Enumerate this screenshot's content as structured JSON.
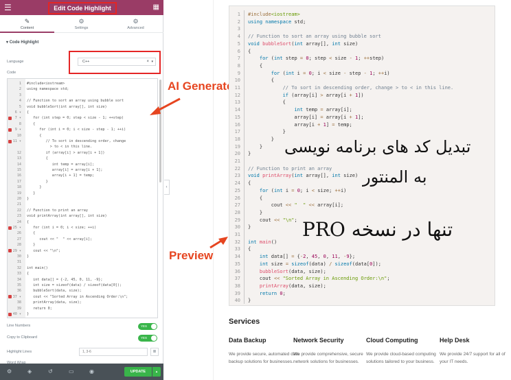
{
  "editor": {
    "title": "Edit Code Highlight",
    "tabs": [
      {
        "label": "Content",
        "icon": "✎"
      },
      {
        "label": "Settings",
        "icon": "⚙"
      },
      {
        "label": "Advanced",
        "icon": "⚙"
      }
    ],
    "section_title": "Code Highlight",
    "language_label": "Language",
    "language_value": "C++",
    "code_label": "Code",
    "code_lines": [
      {
        "n": "1",
        "t": "#include<iostream>",
        "m": false
      },
      {
        "n": "2",
        "t": "using namespace std;",
        "m": false
      },
      {
        "n": "3",
        "t": "",
        "m": false
      },
      {
        "n": "4",
        "t": "// Function to sort an array using bubble sort",
        "m": false
      },
      {
        "n": "5",
        "t": "void bubbleSort(int array[], int size)",
        "m": false
      },
      {
        "n": "6 ▾",
        "t": "{",
        "m": false
      },
      {
        "n": "7 ▾",
        "t": "   for (int step = 0; step < size - 1; ++step)",
        "m": true
      },
      {
        "n": "8",
        "t": "   {",
        "m": false
      },
      {
        "n": "9 ▾",
        "t": "      for (int i = 0; i < size - step - 1; ++i)",
        "m": true
      },
      {
        "n": "10",
        "t": "      {",
        "m": false
      },
      {
        "n": "11 ▾",
        "t": "         // To sort in descending order, change",
        "m": true
      },
      {
        "n": "",
        "t": "           > to < in this line.",
        "m": false
      },
      {
        "n": "12",
        "t": "         if (array[i] > array[i + 1])",
        "m": false
      },
      {
        "n": "13",
        "t": "         {",
        "m": false
      },
      {
        "n": "14",
        "t": "            int temp = array[i];",
        "m": false
      },
      {
        "n": "15",
        "t": "            array[i] = array[i + 1];",
        "m": false
      },
      {
        "n": "16",
        "t": "            array[i + 1] = temp;",
        "m": false
      },
      {
        "n": "17",
        "t": "         }",
        "m": false
      },
      {
        "n": "18",
        "t": "      }",
        "m": false
      },
      {
        "n": "19",
        "t": "   }",
        "m": false
      },
      {
        "n": "20",
        "t": "}",
        "m": false
      },
      {
        "n": "21",
        "t": "",
        "m": false
      },
      {
        "n": "22",
        "t": "// Function to print an array",
        "m": false
      },
      {
        "n": "23",
        "t": "void printArray(int array[], int size)",
        "m": false
      },
      {
        "n": "24",
        "t": "{",
        "m": false
      },
      {
        "n": "25 ▾",
        "t": "   for (int i = 0; i < size; ++i)",
        "m": true
      },
      {
        "n": "26",
        "t": "   {",
        "m": false
      },
      {
        "n": "27",
        "t": "      cout << \"  \" << array[i];",
        "m": false
      },
      {
        "n": "28",
        "t": "   }",
        "m": false
      },
      {
        "n": "29 ▾",
        "t": "   cout << \"\\n\";",
        "m": true
      },
      {
        "n": "30",
        "t": "}",
        "m": false
      },
      {
        "n": "31",
        "t": "",
        "m": false
      },
      {
        "n": "32",
        "t": "int main()",
        "m": false
      },
      {
        "n": "33",
        "t": "{",
        "m": false
      },
      {
        "n": "34",
        "t": "   int data[] = {-2, 45, 0, 11, -9};",
        "m": false
      },
      {
        "n": "35",
        "t": "   int size = sizeof(data) / sizeof(data[0]);",
        "m": false
      },
      {
        "n": "36",
        "t": "   bubbleSort(data, size);",
        "m": false
      },
      {
        "n": "37 ▾",
        "t": "   cout << \"Sorted Array in Ascending Order:\\n\";",
        "m": true
      },
      {
        "n": "38",
        "t": "   printArray(data, size);",
        "m": false
      },
      {
        "n": "39",
        "t": "   return 0;",
        "m": false
      },
      {
        "n": "40 ▾",
        "t": "}",
        "m": true
      }
    ],
    "line_numbers_label": "Line Numbers",
    "copy_label": "Copy to Clipboard",
    "toggle_text": "YES",
    "highlight_label": "Highlight Lines",
    "highlight_placeholder": "1, 3-6",
    "wordwrap_label": "Word Wrap",
    "update_label": "UPDATE"
  },
  "annotations": {
    "ai_generated": "AI Generated",
    "preview": "Preview",
    "fa_line1": "تبدیل کد های برنامه نویسی",
    "fa_line2": "به المنتور",
    "fa_line3": "تنها در نسخه PRO"
  },
  "preview_lines": [
    [
      "1",
      "<span class='o'>#include</span><span class='s'>&lt;iostream&gt;</span>"
    ],
    [
      "2",
      "<span class='k'>using</span> <span class='k'>namespace</span> std;"
    ],
    [
      "3",
      ""
    ],
    [
      "4",
      "<span class='cm'>// Function to sort an array using bubble sort</span>"
    ],
    [
      "5",
      "<span class='k'>void</span> <span class='f'>bubbleSort</span>(<span class='k'>int</span> array[], <span class='k'>int</span> size)"
    ],
    [
      "6",
      "{"
    ],
    [
      "7",
      "    <span class='k'>for</span> (<span class='k'>int</span> step <span class='o'>=</span> <span class='n'>0</span>; step <span class='o'>&lt;</span> size <span class='o'>-</span> <span class='n'>1</span>; <span class='o'>++</span>step)"
    ],
    [
      "8",
      "    {"
    ],
    [
      "9",
      "        <span class='k'>for</span> (<span class='k'>int</span> i <span class='o'>=</span> <span class='n'>0</span>; i <span class='o'>&lt;</span> size <span class='o'>-</span> step <span class='o'>-</span> <span class='n'>1</span>; <span class='o'>++</span>i)"
    ],
    [
      "10",
      "        {"
    ],
    [
      "11",
      "            <span class='cm'>// To sort in descending order, change &gt; to &lt; in this line.</span>"
    ],
    [
      "12",
      "            <span class='k'>if</span> (array[i] <span class='o'>&gt;</span> array[i <span class='o'>+</span> <span class='n'>1</span>])"
    ],
    [
      "13",
      "            {"
    ],
    [
      "14",
      "                <span class='k'>int</span> temp <span class='o'>=</span> array[i];"
    ],
    [
      "15",
      "                array[i] <span class='o'>=</span> array[i <span class='o'>+</span> <span class='n'>1</span>];"
    ],
    [
      "16",
      "                array[i <span class='o'>+</span> <span class='n'>1</span>] <span class='o'>=</span> temp;"
    ],
    [
      "17",
      "            }"
    ],
    [
      "18",
      "        }"
    ],
    [
      "19",
      "    }"
    ],
    [
      "20",
      "}"
    ],
    [
      "21",
      ""
    ],
    [
      "22",
      "<span class='cm'>// Function to print an array</span>"
    ],
    [
      "23",
      "<span class='k'>void</span> <span class='f'>printArray</span>(<span class='k'>int</span> array[], <span class='k'>int</span> size)"
    ],
    [
      "24",
      "{"
    ],
    [
      "25",
      "    <span class='k'>for</span> (<span class='k'>int</span> i <span class='o'>=</span> <span class='n'>0</span>; i <span class='o'>&lt;</span> size; <span class='o'>++</span>i)"
    ],
    [
      "26",
      "    {"
    ],
    [
      "27",
      "        cout <span class='o'>&lt;&lt;</span> <span class='s'>\"  \"</span> <span class='o'>&lt;&lt;</span> array[i];"
    ],
    [
      "28",
      "    }"
    ],
    [
      "29",
      "    cout <span class='o'>&lt;&lt;</span> <span class='s'>\"\\n\"</span>;"
    ],
    [
      "30",
      "}"
    ],
    [
      "31",
      ""
    ],
    [
      "32",
      "<span class='k'>int</span> <span class='f'>main</span>()"
    ],
    [
      "33",
      "{"
    ],
    [
      "34",
      "    <span class='k'>int</span> data[] <span class='o'>=</span> {<span class='o'>-</span><span class='n'>2</span>, <span class='n'>45</span>, <span class='n'>0</span>, <span class='n'>11</span>, <span class='o'>-</span><span class='n'>9</span>};"
    ],
    [
      "35",
      "    <span class='k'>int</span> size <span class='o'>=</span> <span class='k'>sizeof</span>(data) <span class='o'>/</span> <span class='k'>sizeof</span>(data[<span class='n'>0</span>]);"
    ],
    [
      "36",
      "    <span class='f'>bubbleSort</span>(data, size);"
    ],
    [
      "37",
      "    cout <span class='o'>&lt;&lt;</span> <span class='s'>\"Sorted Array in Ascending Order:\\n\"</span>;"
    ],
    [
      "38",
      "    <span class='f'>printArray</span>(data, size);"
    ],
    [
      "39",
      "    <span class='k'>return</span> <span class='n'>0</span>;"
    ],
    [
      "40",
      "}"
    ]
  ],
  "services": {
    "title": "Services",
    "items": [
      {
        "title": "Data Backup",
        "desc": "We provide secure, automated data backup solutions for businesses."
      },
      {
        "title": "Network Security",
        "desc": "We provide comprehensive, secure network solutions for businesses."
      },
      {
        "title": "Cloud Computing",
        "desc": "We provide cloud-based computing solutions tailored to your business."
      },
      {
        "title": "Help Desk",
        "desc": "We provide 24/7 support for all of your IT needs."
      }
    ]
  }
}
